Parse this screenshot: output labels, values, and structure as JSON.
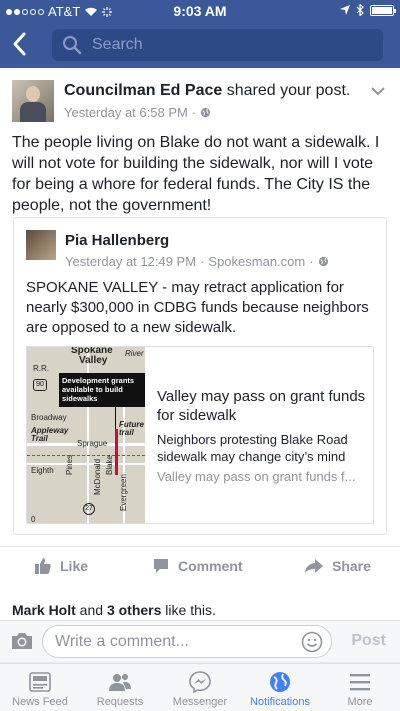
{
  "status_bar": {
    "carrier": "AT&T",
    "time": "9:03 AM"
  },
  "nav": {
    "search_placeholder": "Search"
  },
  "post": {
    "author": "Councilman Ed Pace",
    "action": "shared your post.",
    "timestamp": "Yesterday at 6:58 PM",
    "text": "The people living on Blake do not want a sidewalk. I will not vote for building the sidewalk, nor will I vote for being a whore for federal funds. The City IS the people, not the government!"
  },
  "shared_post": {
    "author": "Pia Hallenberg",
    "timestamp": "Yesterday at 12:49 PM",
    "source": "Spokesman.com",
    "text": "SPOKANE VALLEY - may retract application for nearly $300,000 in CDBG funds because neighbors are opposed to a new sidewalk."
  },
  "link_preview": {
    "title": "Valley may pass on grant funds for sidewalk",
    "description": "Neighbors protesting Blake Road sidewalk may change city’s mind",
    "source_snippet": "Valley may pass on grant funds f...",
    "map": {
      "title_line1": "Spokane",
      "title_line2": "Valley",
      "callout": "Development grants available to build sidewalks",
      "labels": [
        "Broadway",
        "Appleway Trail",
        "Sprague",
        "Future trail",
        "Eighth",
        "Pines",
        "McDonald",
        "Blake",
        "Evergreen",
        "R.R.",
        "River",
        "27",
        "90",
        "0"
      ]
    }
  },
  "actions": {
    "like": "Like",
    "comment": "Comment",
    "share": "Share"
  },
  "likes": {
    "name": "Mark Holt",
    "connector": " and ",
    "others": "3 others",
    "suffix": " like this."
  },
  "comment_bar": {
    "placeholder": "Write a comment...",
    "post_label": "Post"
  },
  "tabs": [
    {
      "label": "News Feed",
      "icon": "news-feed-icon"
    },
    {
      "label": "Requests",
      "icon": "friends-icon"
    },
    {
      "label": "Messenger",
      "icon": "messenger-icon"
    },
    {
      "label": "Notifications",
      "icon": "globe-icon"
    },
    {
      "label": "More",
      "icon": "menu-icon"
    }
  ],
  "colors": {
    "brand": "#3b5998",
    "active_tab": "#4080ff",
    "muted": "#90949c"
  }
}
